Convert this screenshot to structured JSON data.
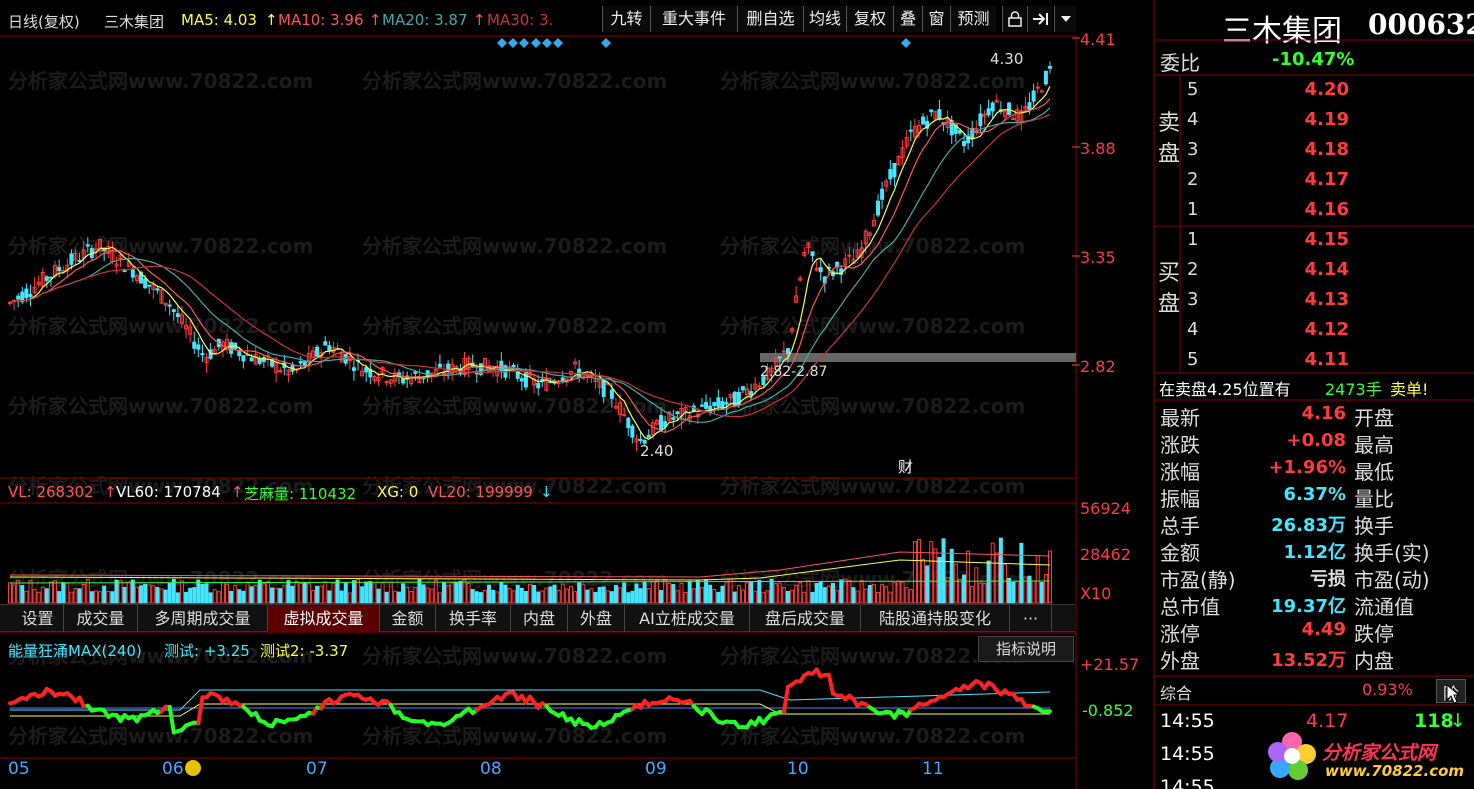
{
  "indicator_bar": {
    "period_label": "日线(复权)",
    "stock_name": "三木集团",
    "ma5": "MA5: 4.03",
    "ma10": "MA10: 3.96",
    "ma20": "MA20: 3.87",
    "ma30": "MA30: 3.",
    "arrow_up": "↑"
  },
  "toolbar": {
    "buttons": [
      "九转",
      "重大事件",
      "删自选",
      "均线",
      "复权",
      "叠",
      "窗",
      "预测"
    ],
    "lock_icon": "lock-icon",
    "arrow_icon": "arrow-right-icon",
    "menu_icon": "chevron-down-icon"
  },
  "header": {
    "title": "三木集团",
    "code": "000632"
  },
  "price_axis": [
    "4.41",
    "3.88",
    "3.35",
    "2.82"
  ],
  "chart_annotations": {
    "high_marker": "4.30",
    "low_marker": "2.40",
    "zone_label": "2.82-2.87",
    "event_badge": "财"
  },
  "volume_bar": {
    "vl": "VL: 268302",
    "vl60": "VL60: 170784",
    "zhima": "芝麻量: 110432",
    "xg": "XG: 0",
    "vl20": "VL20: 199999",
    "up_arrow": "↑",
    "down_arrow": "↓"
  },
  "volume_axis": [
    "56924",
    "28462"
  ],
  "volume_unit": "X10",
  "tabs": [
    "设置",
    "成交量",
    "多周期成交量",
    "虚拟成交量",
    "金额",
    "换手率",
    "内盘",
    "外盘",
    "AI立桩成交量",
    "盘后成交量",
    "陆股通持股变化",
    "···"
  ],
  "active_tab": "虚拟成交量",
  "indicator": {
    "title": "能量狂涌MAX(240)",
    "test1": "测试: +3.25",
    "test2": "测试2: -3.37",
    "help": "指标说明",
    "axis": [
      "+21.57",
      "-0.852"
    ]
  },
  "months": [
    "05",
    "06",
    "07",
    "08",
    "09",
    "10",
    "11"
  ],
  "order_book": {
    "ratio_label": "委比",
    "ratio_value": "-10.47%",
    "sell_label": "卖盘",
    "buy_label": "买盘",
    "sell": [
      {
        "lv": "5",
        "price": "4.20"
      },
      {
        "lv": "4",
        "price": "4.19"
      },
      {
        "lv": "3",
        "price": "4.18"
      },
      {
        "lv": "2",
        "price": "4.17"
      },
      {
        "lv": "1",
        "price": "4.16"
      }
    ],
    "buy": [
      {
        "lv": "1",
        "price": "4.15"
      },
      {
        "lv": "2",
        "price": "4.14"
      },
      {
        "lv": "3",
        "price": "4.13"
      },
      {
        "lv": "4",
        "price": "4.12"
      },
      {
        "lv": "5",
        "price": "4.11"
      }
    ],
    "notice_left": "在卖盘4.25位置有",
    "notice_qty": "2473手",
    "notice_right": "卖单!"
  },
  "stats": [
    {
      "label": "最新",
      "value": "4.16",
      "color": "red",
      "label2": "开盘"
    },
    {
      "label": "涨跌",
      "value": "+0.08",
      "color": "red",
      "label2": "最高"
    },
    {
      "label": "涨幅",
      "value": "+1.96%",
      "color": "red",
      "label2": "最低"
    },
    {
      "label": "振幅",
      "value": "6.37%",
      "color": "cyan",
      "label2": "量比"
    },
    {
      "label": "总手",
      "value": "26.83万",
      "color": "cyan",
      "label2": "换手"
    },
    {
      "label": "金额",
      "value": "1.12亿",
      "color": "cyan",
      "label2": "换手(实)"
    },
    {
      "label": "市盈(静)",
      "value": "亏损",
      "color": "white",
      "label2": "市盈(动)"
    },
    {
      "label": "总市值",
      "value": "19.37亿",
      "color": "cyan",
      "label2": "流通值"
    },
    {
      "label": "涨停",
      "value": "4.49",
      "color": "red",
      "label2": "跌停"
    },
    {
      "label": "外盘",
      "value": "13.52万",
      "color": "red",
      "label2": "内盘"
    }
  ],
  "composite": {
    "label": "综合",
    "value": "0.93%",
    "tab": "阶"
  },
  "ticks": [
    {
      "time": "14:55",
      "price": "4.17",
      "vol": "118",
      "arrow": "↓"
    },
    {
      "time": "14:55",
      "price": "",
      "vol": "",
      "arrow": ""
    },
    {
      "time": "14:55",
      "price": "",
      "vol": "",
      "arrow": ""
    }
  ],
  "logo": {
    "name": "分析家公式网",
    "url": "www.70822.com"
  },
  "watermark": "分析家公式网www.70822.com",
  "colors": {
    "red": "#ff3b3b",
    "green": "#33ff33",
    "cyan": "#44e6ff",
    "yellow": "#ffff44",
    "bg": "#000000"
  }
}
